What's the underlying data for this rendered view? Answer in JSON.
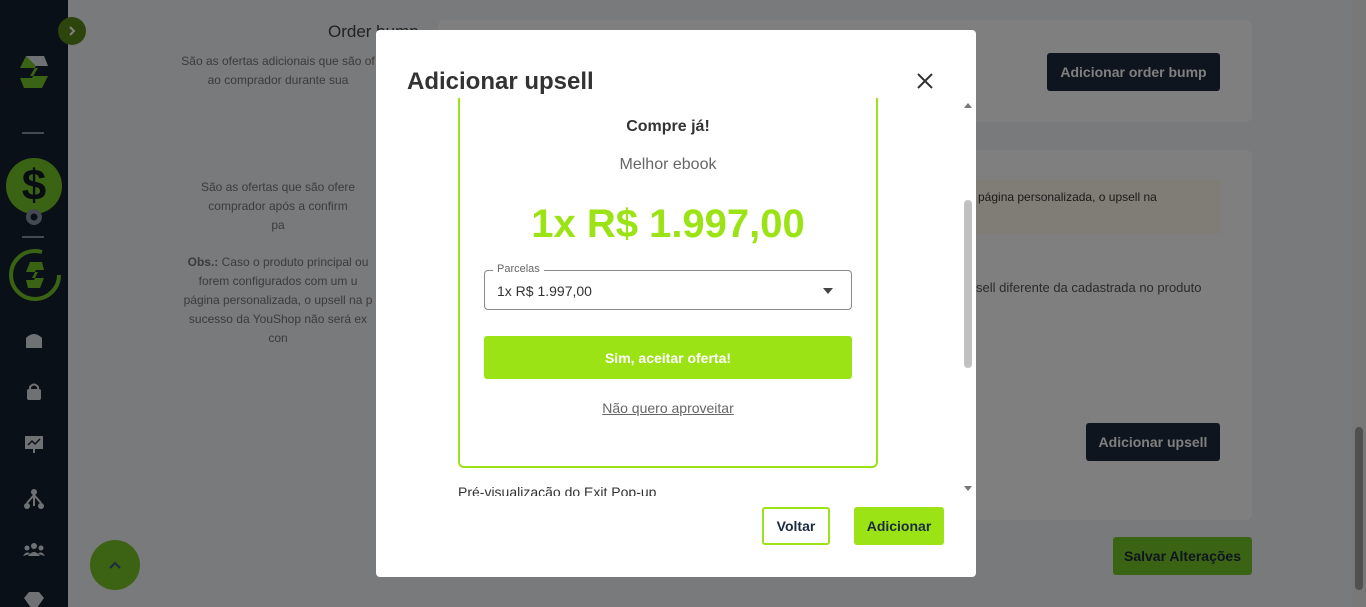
{
  "sidebar": {
    "items": [
      {
        "icon": "dollar-icon"
      },
      {
        "icon": "gear-icon"
      },
      {
        "icon": "logo-ring-icon"
      },
      {
        "icon": "home-icon"
      },
      {
        "icon": "bag-icon"
      },
      {
        "icon": "presentation-icon"
      },
      {
        "icon": "network-icon"
      },
      {
        "icon": "users-icon"
      },
      {
        "icon": "diamond-icon"
      }
    ],
    "dollar_symbol": "$"
  },
  "background": {
    "order_bump_title": "Order bump",
    "order_bump_desc_1": "São as ofertas adicionais que são of",
    "order_bump_desc_2": "ao comprador durante sua",
    "add_order_bump_button": "Adicionar order bump",
    "upsell_desc_1": "São as ofertas que são ofere",
    "upsell_desc_2": "comprador após a confirm",
    "upsell_desc_3": "pa",
    "obs_label": "Obs.:",
    "obs_desc_1": " Caso o produto principal ou",
    "obs_desc_2": "forem configurados com um u",
    "obs_desc_3": "página personalizada, o upsell na p",
    "obs_desc_4": "sucesso da YouShop não será ex",
    "obs_desc_5": "con",
    "note_text": "página personalizada, o upsell na",
    "upsell_info_text": "sell diferente da cadastrada no produto",
    "add_upsell_button": "Adicionar upsell",
    "save_button": "Salvar Alterações"
  },
  "modal": {
    "title": "Adicionar upsell",
    "preview": {
      "title": "Compre já!",
      "subtitle": "Melhor ebook",
      "price": "1x R$ 1.997,00",
      "installments_label": "Parcelas",
      "installments_value": "1x R$ 1.997,00",
      "accept_button": "Sim, aceitar oferta!",
      "decline_link": "Não quero aproveitar"
    },
    "exit_popup_label": "Pré-visualização do Exit Pop-up",
    "back_button": "Voltar",
    "add_button": "Adicionar"
  },
  "colors": {
    "sidebar_bg": "#152131",
    "accent_green": "#9be315",
    "dark_navy": "#1d2b3e",
    "overlay": "rgba(0,0,0,0.5)"
  }
}
